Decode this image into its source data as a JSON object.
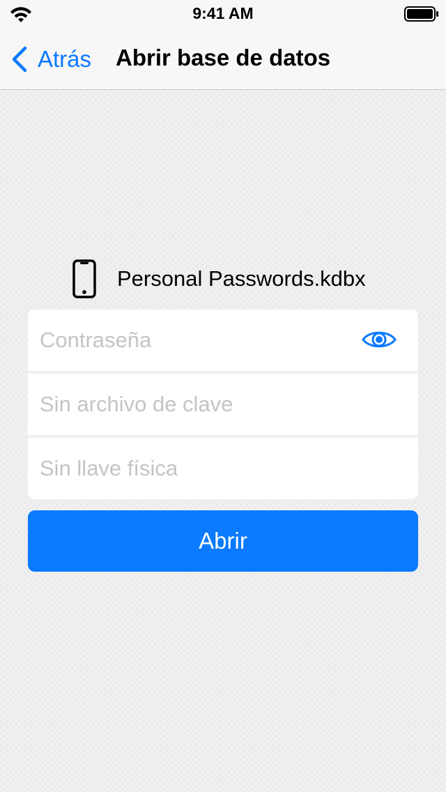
{
  "status_bar": {
    "time": "9:41 AM",
    "icons": [
      "wifi-icon",
      "battery-icon"
    ]
  },
  "nav": {
    "back_label": "Atrás",
    "title": "Abrir base de datos",
    "back_icon": "chevron-left-icon"
  },
  "file": {
    "icon": "phone-icon",
    "name": "Personal Passwords.kdbx"
  },
  "form": {
    "password_placeholder": "Contraseña",
    "keyfile_placeholder": "Sin archivo de clave",
    "hardware_key_placeholder": "Sin llave física",
    "toggle_icon": "eye-icon"
  },
  "actions": {
    "open_label": "Abrir"
  },
  "colors": {
    "accent": "#0a7aff",
    "placeholder": "#c4c4c7",
    "background": "#f1f1f1"
  }
}
